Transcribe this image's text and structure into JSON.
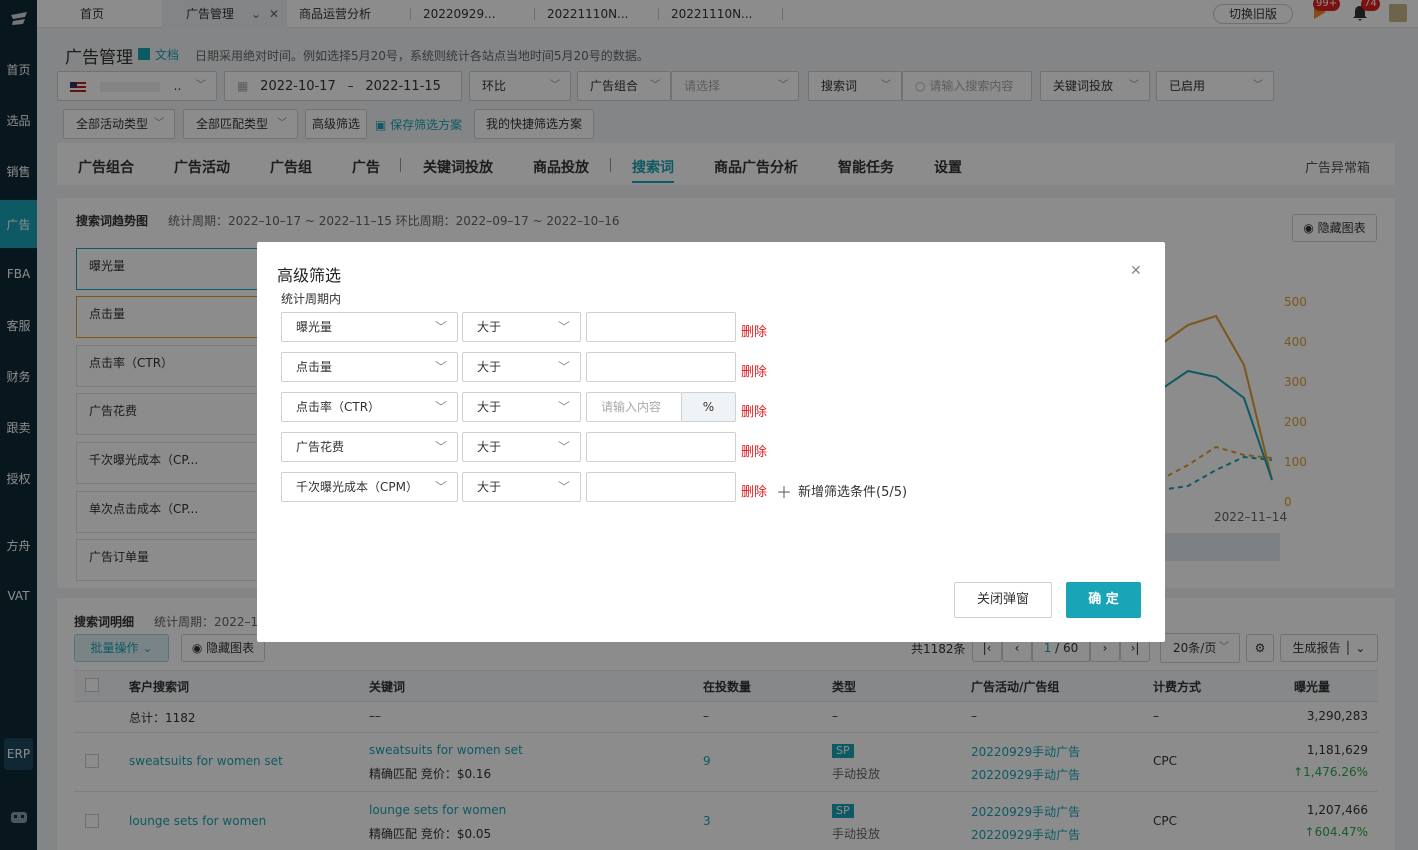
{
  "sidebar": {
    "items": [
      "首页",
      "选品",
      "销售",
      "广告",
      "FBA",
      "客服",
      "财务",
      "跟卖",
      "授权",
      "方舟",
      "VAT"
    ],
    "erp": "ERP"
  },
  "tabs": [
    {
      "label": "首页"
    },
    {
      "label": "广告管理"
    },
    {
      "label": "商品运营分析"
    },
    {
      "label": "20220929..."
    },
    {
      "label": "20221110N..."
    },
    {
      "label": "20221110N..."
    }
  ],
  "topbar": {
    "switch_label": "切换旧版",
    "badge1": "99+",
    "badge2": "74"
  },
  "header": {
    "title": "广告管理",
    "doc_label": "文档",
    "note": "日期采用绝对时间。例如选择5月20号，系统则统计各站点当地时间5月20号的数据。"
  },
  "filters": {
    "country": "..",
    "date_start": "2022-10-17",
    "date_sep": "–",
    "date_end": "2022-11-15",
    "compare": "环比",
    "ad_group": "广告组合",
    "ad_group_placeholder": "请选择",
    "search_type": "搜索词",
    "search_placeholder": "请输入搜索内容",
    "keyword_type": "关键词投放",
    "status": "已启用",
    "campaign_type": "全部活动类型",
    "match_type": "全部匹配类型",
    "advanced": "高级筛选",
    "save_scheme": "保存筛选方案",
    "my_scheme": "我的快捷筛选方案"
  },
  "main_tabs": [
    "广告组合",
    "广告活动",
    "广告组",
    "广告",
    "关键词投放",
    "商品投放",
    "搜索词",
    "商品广告分析",
    "智能任务",
    "设置"
  ],
  "anomaly_box": "广告异常箱",
  "trend": {
    "title": "搜索词趋势图",
    "period": "统计周期：2022–10–17 ~ 2022–11–15 环比周期：2022–09–17 ~ 2022–10–16",
    "hide_chart": "隐藏图表",
    "metrics": [
      "曝光量",
      "点击量",
      "点击率（CTR）",
      "广告花费",
      "千次曝光成本（CP...",
      "单次点击成本（CP...",
      "广告订单量"
    ],
    "y_ticks": [
      "500",
      "400",
      "300",
      "200",
      "100",
      "0"
    ],
    "x_label": "2022–11–14"
  },
  "detail": {
    "title": "搜索词明细",
    "period": "统计周期：2022–1",
    "batch": "批量操作",
    "hide_chart": "隐藏图表",
    "total_label": "共1182条",
    "page_current": "1",
    "page_total": "/ 60",
    "page_size": "20条/页",
    "report": "生成报告",
    "columns": [
      "客户搜索词",
      "关键词",
      "在投数量",
      "类型",
      "广告活动/广告组",
      "计费方式",
      "曝光量"
    ],
    "summary": {
      "label": "总计：1182",
      "keyword": "––",
      "count": "–",
      "type": "–",
      "campaign": "–",
      "billing": "–",
      "impressions": "3,290,283"
    },
    "rows": [
      {
        "term": "sweatsuits for women set",
        "keyword": "sweatsuits for women set",
        "match": "精确匹配 竞价：$0.16",
        "count": "9",
        "type_badge": "SP",
        "type": "手动投放",
        "campaign1": "20220929手动广告",
        "campaign2": "20220929手动广告",
        "billing": "CPC",
        "impressions": "1,181,629",
        "change": "↑1,476.26%"
      },
      {
        "term": "lounge sets for women",
        "keyword": "lounge sets for women",
        "match": "精确匹配 竞价：$0.05",
        "count": "3",
        "type_badge": "SP",
        "type": "手动投放",
        "campaign1": "20220929手动广告",
        "campaign2": "20220929手动广告",
        "billing": "CPC",
        "impressions": "1,207,466",
        "change": "↑604.47%"
      }
    ]
  },
  "modal": {
    "title": "高级筛选",
    "subtitle": "统计周期内",
    "rows": [
      {
        "field": "曝光量",
        "op": "大于",
        "value": ""
      },
      {
        "field": "点击量",
        "op": "大于",
        "value": ""
      },
      {
        "field": "点击率（CTR）",
        "op": "大于",
        "value": "",
        "placeholder": "请输入内容",
        "unit": "%"
      },
      {
        "field": "广告花费",
        "op": "大于",
        "value": ""
      },
      {
        "field": "千次曝光成本（CPM）",
        "op": "大于",
        "value": ""
      }
    ],
    "delete_label": "删除",
    "add_label": "新增筛选条件(5/5)",
    "close_button": "关闭弹窗",
    "confirm_button": "确 定"
  },
  "colors": {
    "accent": "#19a5b7",
    "orange": "#e0a030",
    "delete": "#e02020",
    "sidebar": "#0f2a38"
  }
}
